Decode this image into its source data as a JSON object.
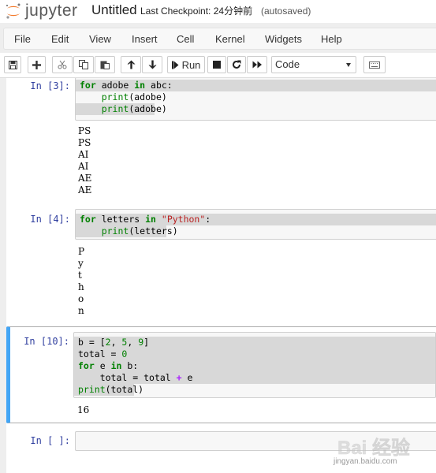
{
  "header": {
    "logo_text": "jupyter",
    "notebook_name": "Untitled",
    "checkpoint": "Last Checkpoint: 24分钟前",
    "autosave": "(autosaved)"
  },
  "menu": [
    "File",
    "Edit",
    "View",
    "Insert",
    "Cell",
    "Kernel",
    "Widgets",
    "Help"
  ],
  "toolbar": {
    "run_label": "Run",
    "cell_type": "Code"
  },
  "cells": [
    {
      "prompt": "In [3]:",
      "outputs": [
        "PS",
        "PS",
        "AI",
        "AI",
        "AE",
        "AE"
      ]
    },
    {
      "prompt": "In [4]:",
      "outputs": [
        "P",
        "y",
        "t",
        "h",
        "o",
        "n"
      ]
    },
    {
      "prompt": "In [10]:",
      "outputs": [
        "16"
      ]
    },
    {
      "prompt": "In [ ]:"
    }
  ],
  "code": {
    "c0_l0_for": "for",
    "c0_l0_a": " adobe ",
    "c0_l0_in": "in",
    "c0_l0_b": " abc:",
    "c0_l1_print": "print",
    "c0_l1_rest": "(adobe)",
    "c0_l2_print": "print",
    "c0_l2_rest": "(adobe)",
    "c1_l0_for": "for",
    "c1_l0_a": " letters ",
    "c1_l0_in": "in",
    "c1_l0_sp": " ",
    "c1_l0_str": "\"Python\"",
    "c1_l0_colon": ":",
    "c1_l1_print": "print",
    "c1_l1_rest": "(letters)",
    "c2_l0_a": "b = [",
    "c2_l0_n1": "2",
    "c2_l0_c1": ", ",
    "c2_l0_n2": "5",
    "c2_l0_c2": ", ",
    "c2_l0_n3": "9",
    "c2_l0_end": "]",
    "c2_l1_a": "total = ",
    "c2_l1_n": "0",
    "c2_l2_for": "for",
    "c2_l2_a": " e ",
    "c2_l2_in": "in",
    "c2_l2_b": " b:",
    "c2_l3_a": "total = total ",
    "c2_l3_op": "+",
    "c2_l3_b": " e",
    "c2_l4_print": "print",
    "c2_l4_rest": "(total)"
  },
  "watermark": {
    "brand": "Bai 经验",
    "url": "jingyan.baidu.com"
  },
  "colors": {
    "selected_cell_border": "#42a5f5",
    "prompt_in": "#303f9f",
    "keyword": "#008000",
    "string": "#ba2121",
    "operator": "#aa22ff"
  }
}
